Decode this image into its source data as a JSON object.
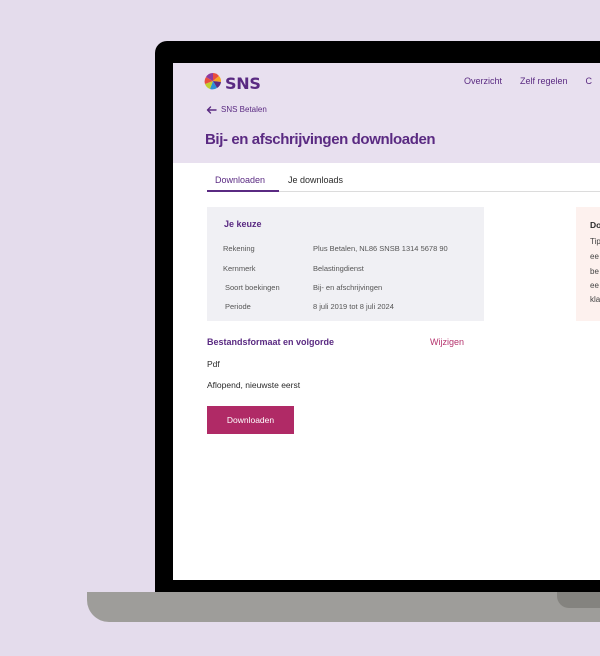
{
  "brand": {
    "name": "SNS"
  },
  "nav": {
    "items": [
      "Overzicht",
      "Zelf regelen",
      "C"
    ]
  },
  "back_link": {
    "label": "SNS Betalen"
  },
  "page_title": "Bij- en afschrijvingen downloaden",
  "tabs": [
    {
      "label": "Downloaden",
      "active": true
    },
    {
      "label": "Je downloads",
      "active": false
    }
  ],
  "choice": {
    "title": "Je keuze",
    "rows": [
      {
        "label": "Rekening",
        "value": "Plus Betalen, NL86 SNSB 1314 5678 90"
      },
      {
        "label": "Kernmerk",
        "value": "Belastingdienst"
      },
      {
        "label": "Soort boekingen",
        "value": "Bij- en afschrijvingen"
      },
      {
        "label": "Periode",
        "value": "8 juli 2019 tot 8 juli 2024"
      }
    ]
  },
  "info": {
    "title": "Do",
    "lines": [
      "Tip",
      "ee",
      "be",
      "ee",
      "kla"
    ]
  },
  "format": {
    "title": "Bestandsformaat en volgorde",
    "change_label": "Wijzigen",
    "file_type": "Pdf",
    "order": "Aflopend, nieuwste eerst"
  },
  "download_button": {
    "label": "Downloaden"
  },
  "colors": {
    "brand_purple": "#5a2a82",
    "accent_pink": "#b02a66",
    "background": "#e4dcec"
  }
}
